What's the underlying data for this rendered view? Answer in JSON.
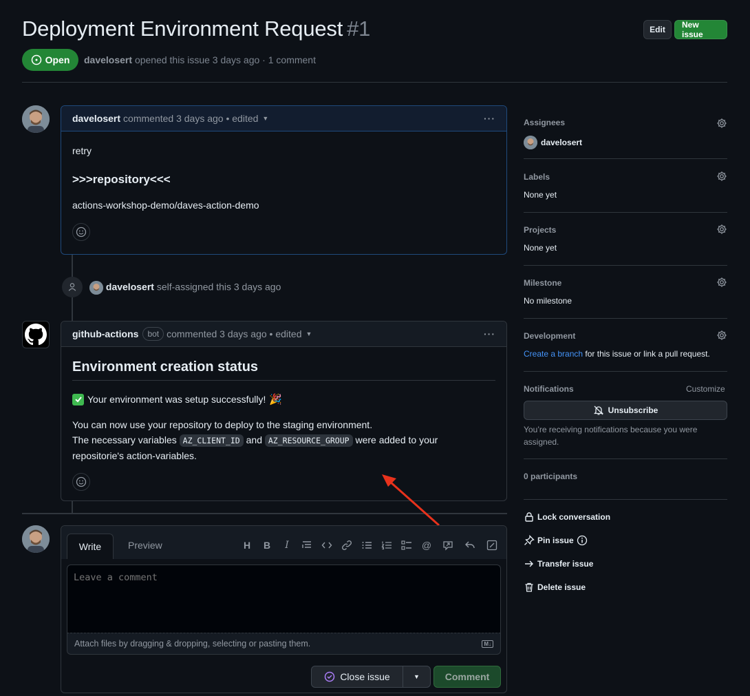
{
  "issue": {
    "title": "Deployment Environment Request",
    "number": "#1",
    "state": "Open",
    "author": "davelosert",
    "meta_rest": "opened this issue 3 days ago · 1 comment"
  },
  "header_actions": {
    "edit": "Edit",
    "new_issue": "New issue"
  },
  "comments": [
    {
      "author": "davelosert",
      "meta": "commented 3 days ago • edited",
      "body": {
        "line1": "retry",
        "heading": ">>>repository<<<",
        "line2": "actions-workshop-demo/daves-action-demo"
      }
    },
    {
      "author": "github-actions",
      "badge": "bot",
      "meta": "commented 3 days ago • edited",
      "body": {
        "heading": "Environment creation status",
        "success": "Your environment was setup successfully!",
        "line1": "You can now use your repository to deploy to the staging environment.",
        "line2_a": "The necessary variables",
        "code1": "AZ_CLIENT_ID",
        "line2_b": "and",
        "code2": "AZ_RESOURCE_GROUP",
        "line2_c": "were added to your",
        "line3": "repositorie's action-variables."
      }
    }
  ],
  "event": {
    "actor": "davelosert",
    "text": "self-assigned this 3 days ago"
  },
  "composer": {
    "tab_write": "Write",
    "tab_preview": "Preview",
    "placeholder": "Leave a comment",
    "attach_text": "Attach files by dragging & dropping, selecting or pasting them.",
    "close_issue": "Close issue",
    "comment": "Comment"
  },
  "sidebar": {
    "assignees": {
      "title": "Assignees",
      "value": "davelosert"
    },
    "labels": {
      "title": "Labels",
      "value": "None yet"
    },
    "projects": {
      "title": "Projects",
      "value": "None yet"
    },
    "milestone": {
      "title": "Milestone",
      "value": "No milestone"
    },
    "development": {
      "title": "Development",
      "link": "Create a branch",
      "rest": "for this issue or link a pull request."
    },
    "notifications": {
      "title": "Notifications",
      "customize": "Customize",
      "unsubscribe": "Unsubscribe",
      "note_line1": "You’re receiving notifications because you were",
      "note_line2": "assigned."
    },
    "participants": "0 participants",
    "actions": {
      "lock": "Lock conversation",
      "pin": "Pin issue",
      "transfer": "Transfer issue",
      "delete": "Delete issue"
    }
  },
  "colors": {
    "accent_green": "#238636",
    "link_blue": "#4493f8",
    "arrow_red": "#e8321c"
  }
}
